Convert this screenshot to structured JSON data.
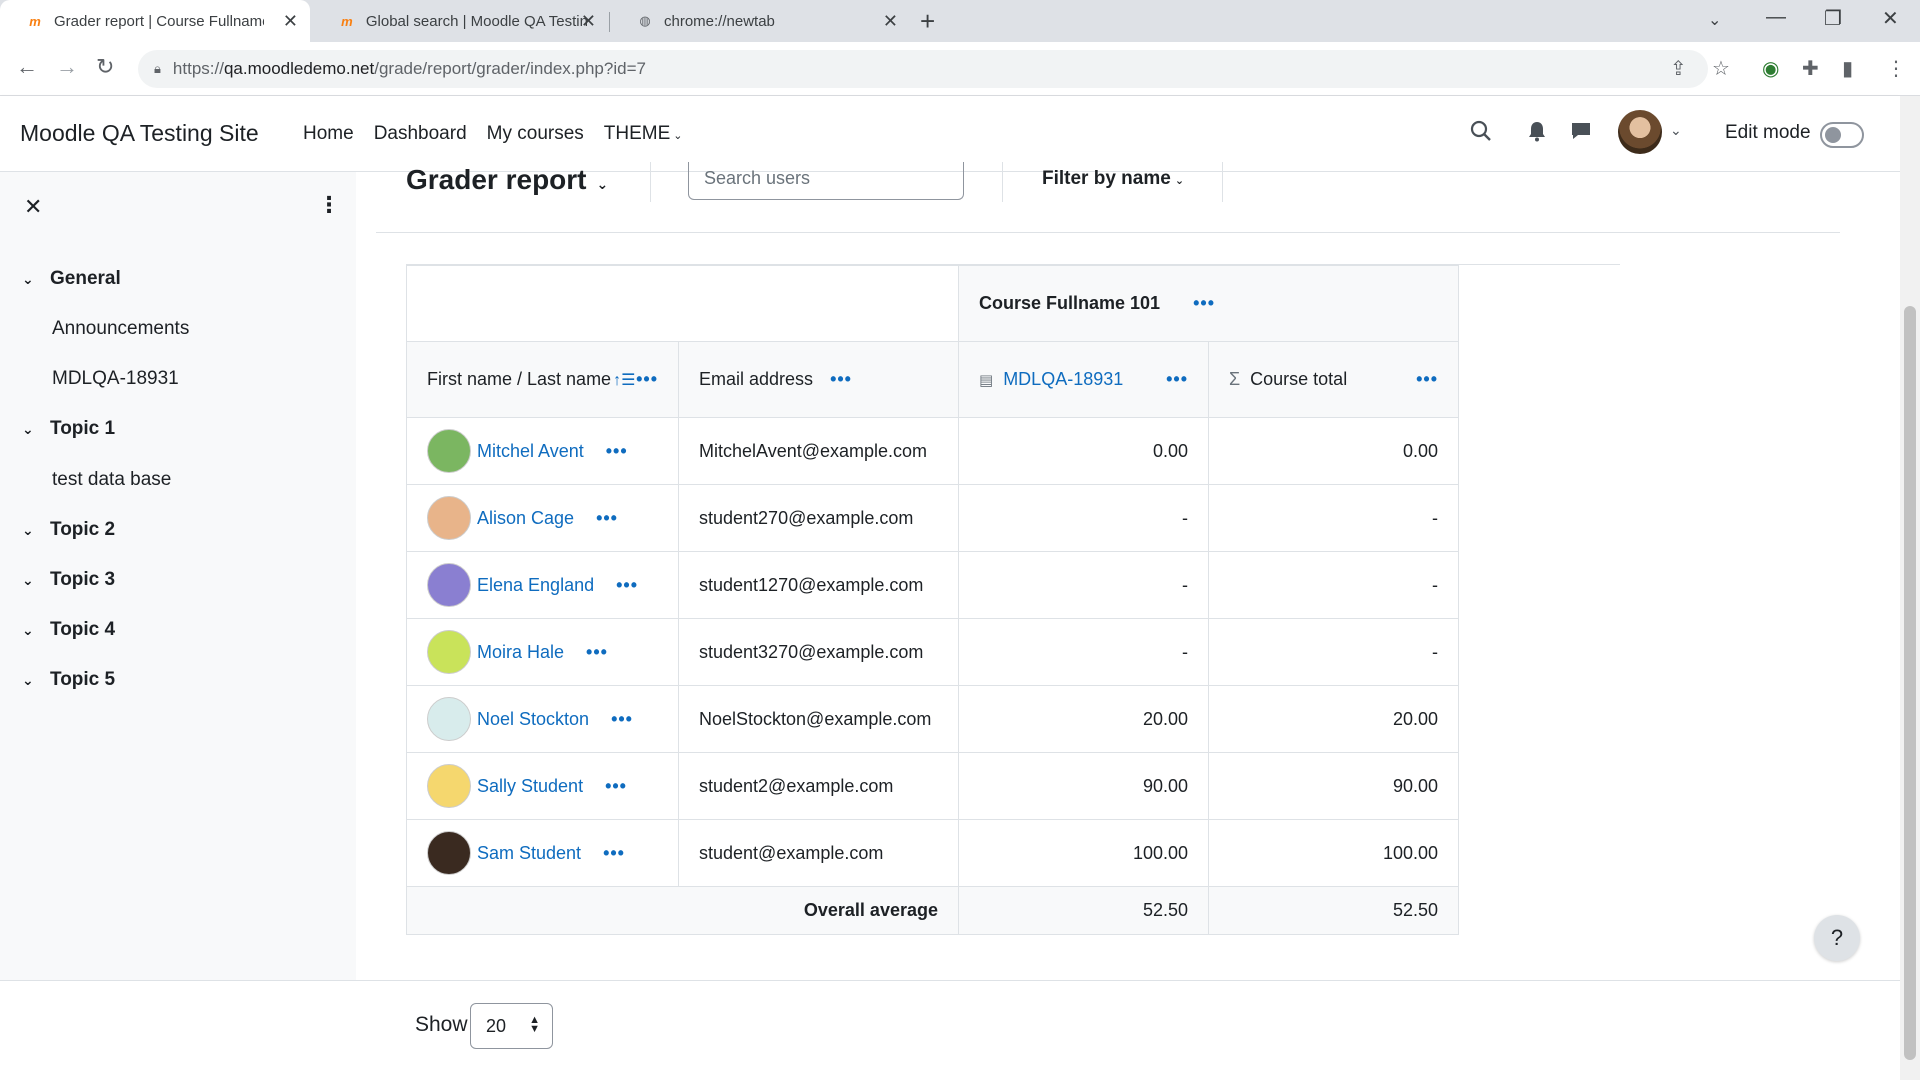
{
  "browser": {
    "tabs": [
      {
        "title": "Grader report | Course Fullname",
        "active": true
      },
      {
        "title": "Global search | Moodle QA Testin",
        "active": false
      },
      {
        "title": "chrome://newtab",
        "active": false
      }
    ],
    "url_prefix": "https://",
    "url_host": "qa.moodledemo.net",
    "url_path": "/grade/report/grader/index.php?id=7"
  },
  "header": {
    "site_name": "Moodle QA Testing Site",
    "nav": [
      "Home",
      "Dashboard",
      "My courses",
      "THEME"
    ],
    "edit_mode_label": "Edit mode"
  },
  "course_index": {
    "items": [
      {
        "label": "General",
        "type": "section"
      },
      {
        "label": "Announcements",
        "type": "activity"
      },
      {
        "label": "MDLQA-18931",
        "type": "activity"
      },
      {
        "label": "Topic 1",
        "type": "section"
      },
      {
        "label": "test data base",
        "type": "activity"
      },
      {
        "label": "Topic 2",
        "type": "section"
      },
      {
        "label": "Topic 3",
        "type": "section"
      },
      {
        "label": "Topic 4",
        "type": "section"
      },
      {
        "label": "Topic 5",
        "type": "section"
      }
    ]
  },
  "main": {
    "page_title": "Grader report",
    "search_placeholder": "Search users",
    "filter_label": "Filter by name",
    "course_header": "Course Fullname 101",
    "columns": {
      "name": "First name / Last name",
      "email": "Email address",
      "item": "MDLQA-18931",
      "total": "Course total"
    },
    "rows": [
      {
        "name": "Mitchel Avent",
        "email": "MitchelAvent@example.com",
        "item": "0.00",
        "total": "0.00",
        "avatar_color": "#7bb661"
      },
      {
        "name": "Alison Cage",
        "email": "student270@example.com",
        "item": "-",
        "total": "-",
        "avatar_color": "#e8b48a"
      },
      {
        "name": "Elena England",
        "email": "student1270@example.com",
        "item": "-",
        "total": "-",
        "avatar_color": "#8a7fd1"
      },
      {
        "name": "Moira Hale",
        "email": "student3270@example.com",
        "item": "-",
        "total": "-",
        "avatar_color": "#c9e35a"
      },
      {
        "name": "Noel Stockton",
        "email": "NoelStockton@example.com",
        "item": "20.00",
        "total": "20.00",
        "avatar_color": "#d8ecec"
      },
      {
        "name": "Sally Student",
        "email": "student2@example.com",
        "item": "90.00",
        "total": "90.00",
        "avatar_color": "#f5d76e"
      },
      {
        "name": "Sam Student",
        "email": "student@example.com",
        "item": "100.00",
        "total": "100.00",
        "avatar_color": "#3a2a20"
      }
    ],
    "overall_average_label": "Overall average",
    "overall_average_item": "52.50",
    "overall_average_total": "52.50"
  },
  "footer": {
    "show_label": "Show",
    "per_page_value": "20"
  },
  "help_label": "?",
  "colors": {
    "link": "#0f6cbf",
    "moodle_orange": "#f98012"
  }
}
